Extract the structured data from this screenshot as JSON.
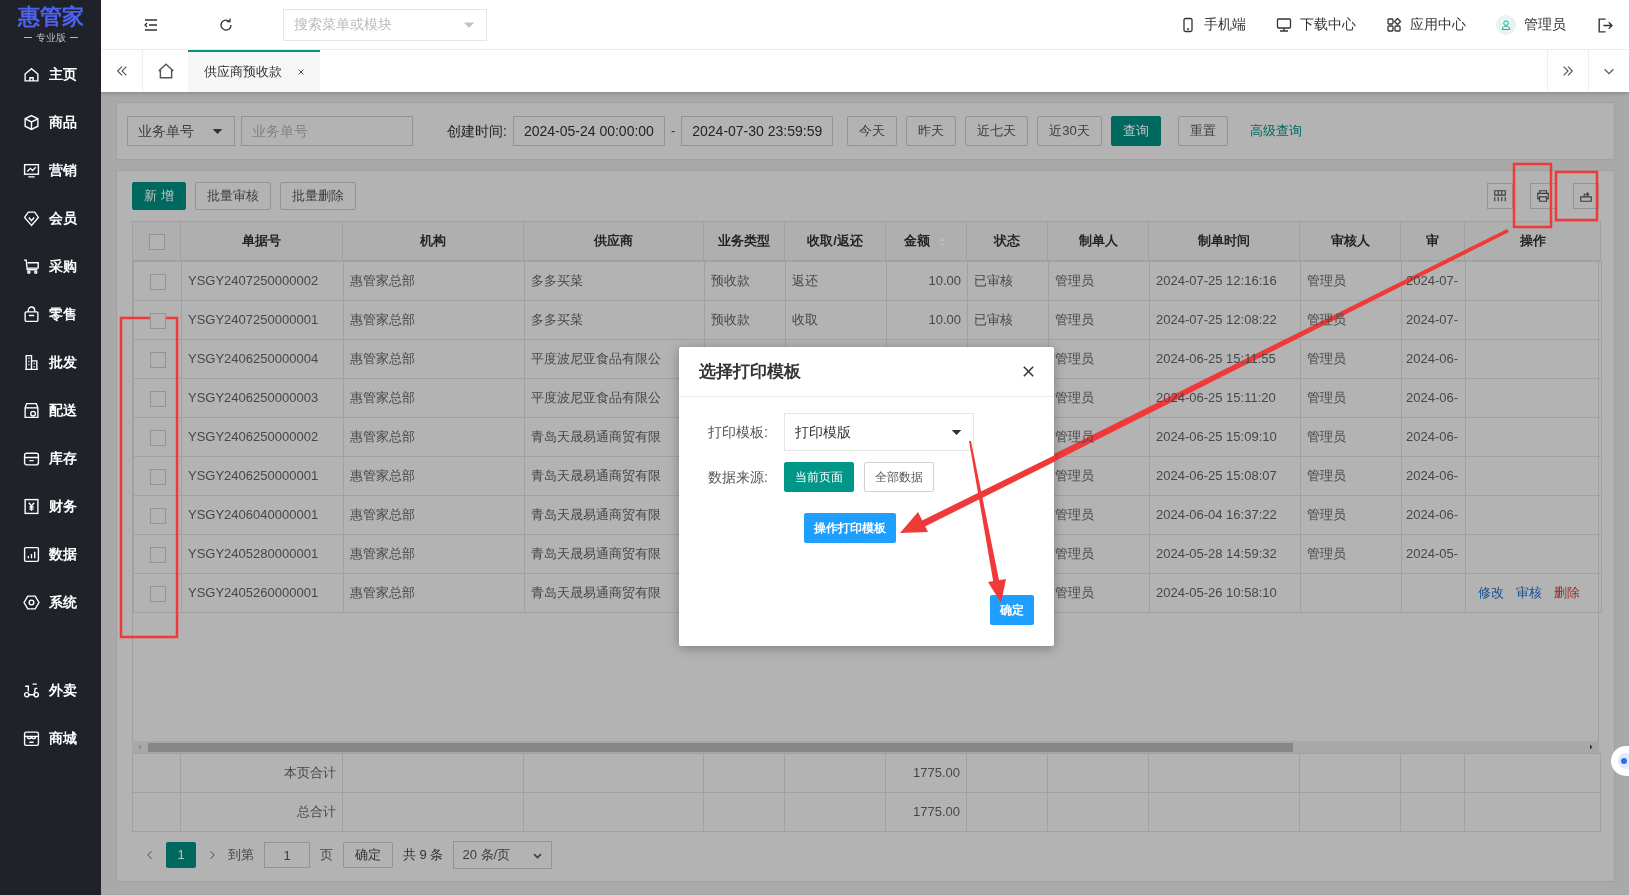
{
  "sidebar": {
    "logo": "惠管家",
    "edition": "专业版",
    "items": [
      {
        "label": "主页"
      },
      {
        "label": "商品"
      },
      {
        "label": "营销"
      },
      {
        "label": "会员"
      },
      {
        "label": "采购"
      },
      {
        "label": "零售"
      },
      {
        "label": "批发"
      },
      {
        "label": "配送"
      },
      {
        "label": "库存"
      },
      {
        "label": "财务"
      },
      {
        "label": "数据"
      },
      {
        "label": "系统"
      }
    ],
    "extra_items": [
      {
        "label": "外卖"
      },
      {
        "label": "商城"
      }
    ]
  },
  "header": {
    "search_placeholder": "搜索菜单或模块",
    "links": [
      {
        "label": "手机端"
      },
      {
        "label": "下载中心"
      },
      {
        "label": "应用中心"
      }
    ],
    "user": "管理员"
  },
  "tabs": [
    {
      "label": "供应商预收款",
      "selected": true
    }
  ],
  "filter": {
    "field_select": "业务单号",
    "field_placeholder": "业务单号",
    "date_label": "创建时间:",
    "date_start": "2024-05-24 00:00:00",
    "date_separator": "-",
    "date_end": "2024-07-30 23:59:59",
    "quick_ranges": [
      "今天",
      "昨天",
      "近七天",
      "近30天"
    ],
    "search_button": "查询",
    "reset_button": "重置",
    "advanced_link": "高级查询"
  },
  "toolbar": {
    "buttons": [
      {
        "label": "新 增",
        "kind": "primary"
      },
      {
        "label": "批量审核",
        "kind": "default"
      },
      {
        "label": "批量删除",
        "kind": "default"
      }
    ]
  },
  "table": {
    "all_checked": false,
    "columns": [
      {
        "label": "单据号",
        "sortable": false
      },
      {
        "label": "机构",
        "sortable": false
      },
      {
        "label": "供应商",
        "sortable": false
      },
      {
        "label": "业务类型",
        "sortable": false
      },
      {
        "label": "收取/返还",
        "sortable": false
      },
      {
        "label": "金额",
        "sortable": true
      },
      {
        "label": "状态",
        "sortable": false
      },
      {
        "label": "制单人",
        "sortable": false
      },
      {
        "label": "制单时间",
        "sortable": false
      },
      {
        "label": "审核人",
        "sortable": false
      },
      {
        "label": "审",
        "sortable": false
      },
      {
        "label": "操作",
        "sortable": false
      }
    ],
    "rows": [
      {
        "checked": false,
        "cells": [
          "YSGY2407250000002",
          "惠管家总部",
          "多多买菜",
          "预收款",
          "返还",
          "10.00",
          "已审核",
          "管理员",
          "2024-07-25 12:16:16",
          "管理员",
          "2024-07-"
        ]
      },
      {
        "checked": false,
        "cells": [
          "YSGY2407250000001",
          "惠管家总部",
          "多多买菜",
          "预收款",
          "收取",
          "10.00",
          "已审核",
          "管理员",
          "2024-07-25 12:08:22",
          "管理员",
          "2024-07-"
        ]
      },
      {
        "checked": false,
        "cells": [
          "YSGY2406250000004",
          "惠管家总部",
          "平度波尼亚食品有限公",
          null,
          null,
          null,
          null,
          "管理员",
          "2024-06-25 15:11:55",
          "管理员",
          "2024-06-"
        ]
      },
      {
        "checked": false,
        "cells": [
          "YSGY2406250000003",
          "惠管家总部",
          "平度波尼亚食品有限公",
          null,
          null,
          null,
          null,
          "管理员",
          "2024-06-25 15:11:20",
          "管理员",
          "2024-06-"
        ]
      },
      {
        "checked": false,
        "cells": [
          "YSGY2406250000002",
          "惠管家总部",
          "青岛天晟易通商贸有限",
          null,
          null,
          null,
          null,
          "管理员",
          "2024-06-25 15:09:10",
          "管理员",
          "2024-06-"
        ]
      },
      {
        "checked": false,
        "cells": [
          "YSGY2406250000001",
          "惠管家总部",
          "青岛天晟易通商贸有限",
          null,
          null,
          null,
          null,
          "管理员",
          "2024-06-25 15:08:07",
          "管理员",
          "2024-06-"
        ]
      },
      {
        "checked": false,
        "cells": [
          "YSGY2406040000001",
          "惠管家总部",
          "青岛天晟易通商贸有限",
          null,
          null,
          null,
          null,
          "管理员",
          "2024-06-04 16:37:22",
          "管理员",
          "2024-06-"
        ]
      },
      {
        "checked": false,
        "cells": [
          "YSGY2405280000001",
          "惠管家总部",
          "青岛天晟易通商贸有限",
          null,
          null,
          null,
          null,
          "管理员",
          "2024-05-28 14:59:32",
          "管理员",
          "2024-05-"
        ]
      },
      {
        "checked": false,
        "cells": [
          "YSGY2405260000001",
          "惠管家总部",
          "青岛天晟易通商贸有限",
          null,
          null,
          null,
          null,
          "管理员",
          "2024-05-26 10:58:10",
          null,
          null
        ],
        "actions": [
          {
            "label": "修改",
            "kind": "edit"
          },
          {
            "label": "审核",
            "kind": "audit"
          },
          {
            "label": "删除",
            "kind": "delete"
          }
        ]
      }
    ],
    "totals": [
      {
        "label": "本页合计",
        "amount": "1775.00"
      },
      {
        "label": "总合计",
        "amount": "1775.00"
      }
    ]
  },
  "pagination": {
    "pages": [
      {
        "label": "1",
        "selected": true
      }
    ],
    "goto_label": "到第",
    "goto_value": "1",
    "page_unit": "页",
    "confirm": "确定",
    "total": "共 9 条",
    "page_size": "20 条/页"
  },
  "modal": {
    "title": "选择打印模板",
    "template_label": "打印模板:",
    "template_value": "打印模版",
    "source_label": "数据来源:",
    "sources": [
      {
        "label": "当前页面",
        "selected": true
      },
      {
        "label": "全部数据",
        "selected": false
      }
    ],
    "design_button": "操作打印模板",
    "ok_button": "确定"
  }
}
